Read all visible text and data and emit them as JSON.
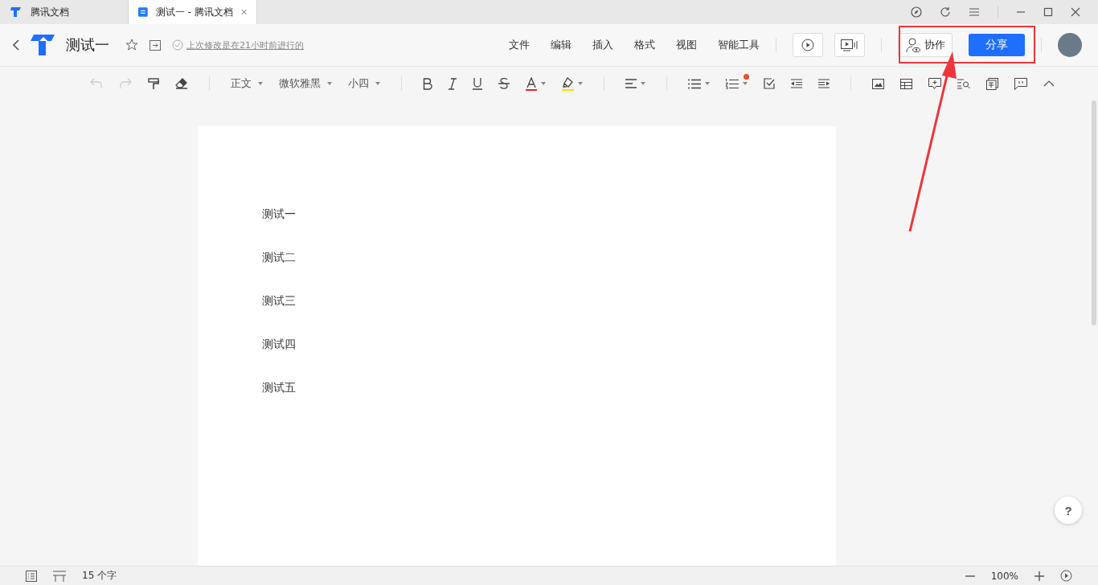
{
  "tabs": [
    {
      "label": "腾讯文档",
      "kind": "home",
      "selected": false
    },
    {
      "label": "测试一 - 腾讯文档",
      "kind": "doc",
      "selected": true
    }
  ],
  "header": {
    "title": "测试一",
    "last_saved": "上次修改是在21小时前进行的",
    "menu": [
      "文件",
      "编辑",
      "插入",
      "格式",
      "视图",
      "智能工具"
    ],
    "collab_button": "协作",
    "share_button": "分享"
  },
  "toolbar": {
    "undo_disabled": true,
    "redo_disabled": true,
    "style": "正文",
    "font": "微软雅黑",
    "size": "小四"
  },
  "document": {
    "paragraphs": [
      "测试一",
      "测试二",
      "测试三",
      "测试四",
      "测试五"
    ]
  },
  "status_bar": {
    "word_count": "15 个字",
    "zoom": "100%"
  },
  "help_button": "?"
}
